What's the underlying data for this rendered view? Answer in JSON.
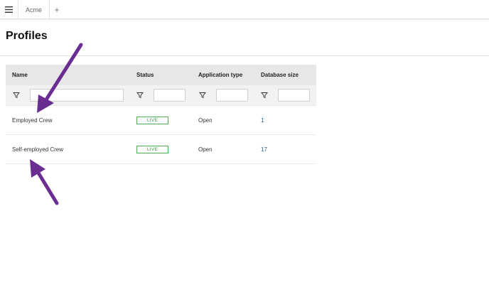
{
  "topbar": {
    "tab_label": "Acme",
    "add_tab_label": "+"
  },
  "page": {
    "title": "Profiles"
  },
  "table": {
    "columns": [
      "Name",
      "Status",
      "Application type",
      "Database size"
    ],
    "rows": [
      {
        "name": "Employed Crew",
        "status": "LIVE",
        "application_type": "Open",
        "database_size": "1"
      },
      {
        "name": "Self-employed Crew",
        "status": "LIVE",
        "application_type": "Open",
        "database_size": "17"
      }
    ]
  },
  "icons": {
    "menu": "hamburger-icon",
    "filter": "funnel-icon",
    "annotation": "purple-arrow"
  },
  "colors": {
    "live_badge": "#4caf50",
    "annotation_arrow": "#6a2d91",
    "header_bg": "#e7e7e7"
  }
}
